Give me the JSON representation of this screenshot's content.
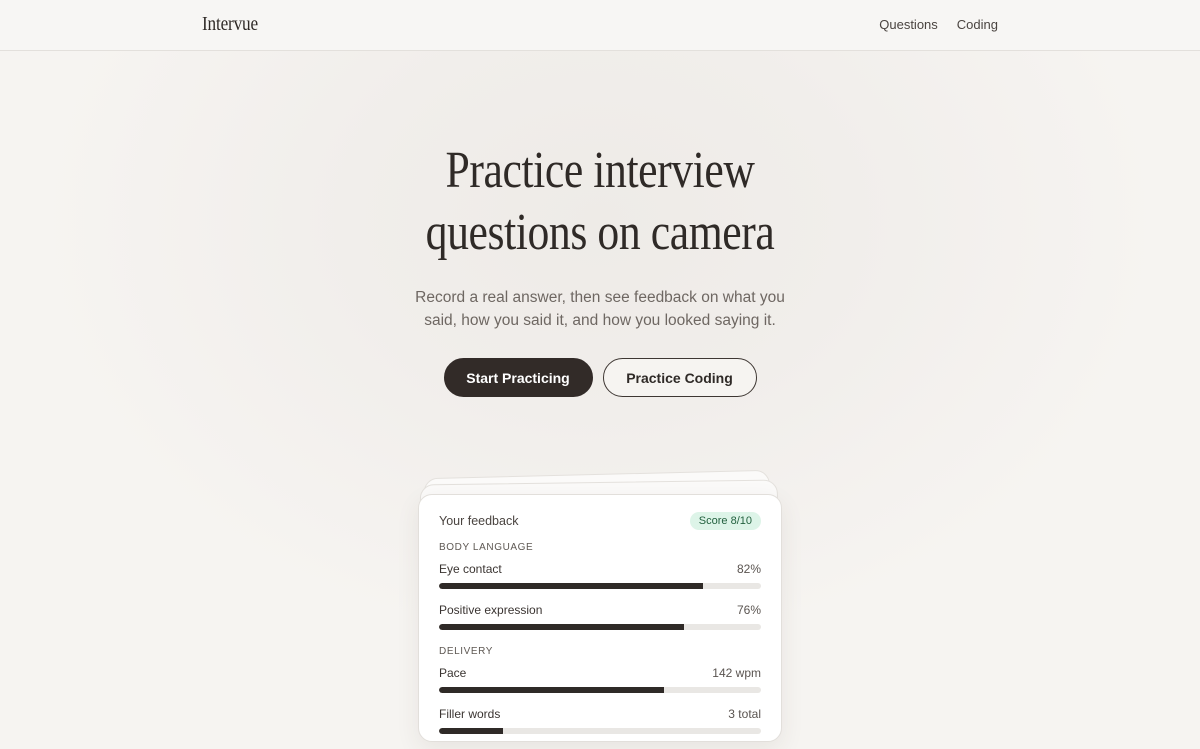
{
  "brand": "Intervue",
  "nav": {
    "questions": "Questions",
    "coding": "Coding"
  },
  "hero": {
    "title_line1": "Practice interview",
    "title_line2": "questions on camera",
    "subtitle": "Record a real answer, then see feedback on what you said, how you said it, and how you looked saying it.",
    "primary_button": "Start Practicing",
    "secondary_button": "Practice Coding"
  },
  "feedback_card": {
    "title": "Your feedback",
    "score": "Score 8/10",
    "sections": [
      {
        "label": "BODY LANGUAGE",
        "metrics": [
          {
            "name": "Eye contact",
            "value": "82%",
            "fill": 0.82
          },
          {
            "name": "Positive expression",
            "value": "76%",
            "fill": 0.76
          }
        ]
      },
      {
        "label": "DELIVERY",
        "metrics": [
          {
            "name": "Pace",
            "value": "142 wpm",
            "fill": 0.7
          },
          {
            "name": "Filler words",
            "value": "3 total",
            "fill": 0.2
          }
        ]
      }
    ]
  },
  "colors": {
    "background": "#f6f4f1",
    "primary_button": "#322b28",
    "score_badge_bg": "#ddf4e8",
    "score_badge_text": "#23613f",
    "bar_fill": "#2f2a27",
    "bar_track": "#e9e7e4"
  }
}
